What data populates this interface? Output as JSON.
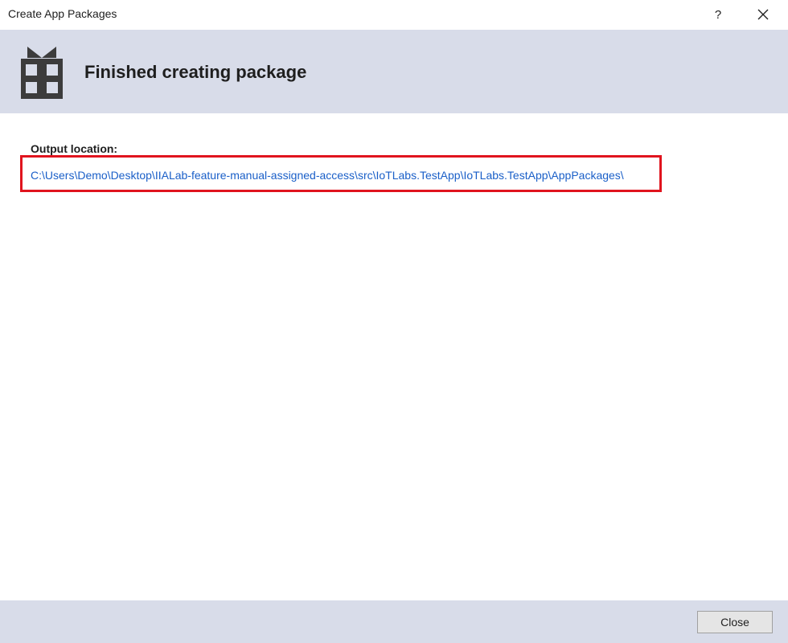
{
  "window": {
    "title": "Create App Packages",
    "help_label": "?"
  },
  "header": {
    "title": "Finished creating package",
    "icon": "gift-icon"
  },
  "content": {
    "output_label": "Output location:",
    "output_path": "C:\\Users\\Demo\\Desktop\\IIALab-feature-manual-assigned-access\\src\\IoTLabs.TestApp\\IoTLabs.TestApp\\AppPackages\\"
  },
  "footer": {
    "close_label": "Close"
  },
  "colors": {
    "header_background": "#d8dce9",
    "link": "#1a5fc8",
    "highlight": "#e0141e"
  }
}
